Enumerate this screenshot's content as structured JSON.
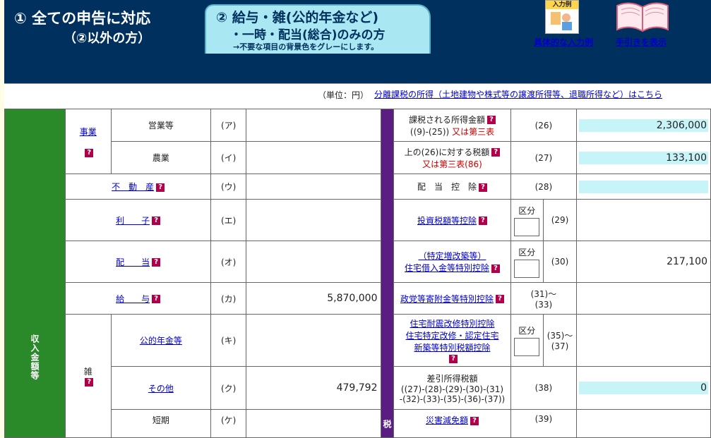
{
  "tabs": {
    "tab1": {
      "line1": "① 全ての申告に対応",
      "line2": "（②以外の方）"
    },
    "tab2": {
      "line1": "② 給与・雑(公的年金など)",
      "line2": "・一時・配当(総合)のみの方",
      "line3": "→不要な項目の背景色をグレーにします。"
    }
  },
  "tools": {
    "example": {
      "icon_caption": "入力例",
      "label": "具体的な入力例"
    },
    "guide": {
      "label": "手引きを表示"
    }
  },
  "unit": "（単位：円）",
  "separate_link": "分離課税の所得（土地建物や株式等の譲渡所得等、退職所得など）はこちら",
  "left": {
    "group_income_label": "収入金額等",
    "jigyo": "事業",
    "eigyo": "営業等",
    "eigyo_code": "(ア)",
    "nogyo": "農業",
    "nogyo_code": "(イ)",
    "fudosan": "不　動　産",
    "fudosan_code": "(ウ)",
    "rishi": "利　　子",
    "rishi_code": "(エ)",
    "haito": "配　　当",
    "haito_code": "(オ)",
    "kyuyo": "給　　与",
    "kyuyo_code": "(カ)",
    "kyuyo_value": "5,870,000",
    "zatsu": "雑",
    "nenkin": "公的年金等",
    "nenkin_code": "(キ)",
    "sonota": "その他",
    "sonota_code": "(ク)",
    "sonota_value": "479,792",
    "tanki": "短期",
    "tanki_code": "(ケ)"
  },
  "right": {
    "group_tax_label": "税",
    "r26_l1": "課税される所得金額",
    "r26_l2a": "((9)-(25))",
    "r26_l2b": "又は第三表",
    "r26_code": "(26)",
    "r26_value": "2,306,000",
    "r27_l1": "上の(26)に対する税額",
    "r27_l2": "又は第三表(86)",
    "r27_code": "(27)",
    "r27_value": "133,100",
    "r28_label": "配　当　控　除",
    "r28_code": "(28)",
    "r29_label": "投資税額等控除",
    "r29_kubun": "区分",
    "r29_code": "(29)",
    "r30_l1": "（特定増改築等）",
    "r30_l2": "住宅借入金等特別控除",
    "r30_kubun": "区分",
    "r30_code": "(30)",
    "r30_value": "217,100",
    "r31_label": "政党等寄附金等特別控除",
    "r31_code_a": "(31)～",
    "r31_code_b": "(33)",
    "r35_l1": "住宅耐震改修特別控除",
    "r35_l2": "住宅特定改修・認定住宅",
    "r35_l3": "新築等特別税額控除",
    "r35_kubun": "区分",
    "r35_code_a": "(35)～",
    "r35_code_b": "(37)",
    "r38_l1": "差引所得税額",
    "r38_l2": "((27)-(28)-(29)-(30)-(31)",
    "r38_l3": "-(32)-(33)-(35)-(36)-(37))",
    "r38_code": "(38)",
    "r38_value": "0",
    "r39_label": "災害減免額",
    "r39_code": "(39)"
  },
  "help_glyph": "?"
}
